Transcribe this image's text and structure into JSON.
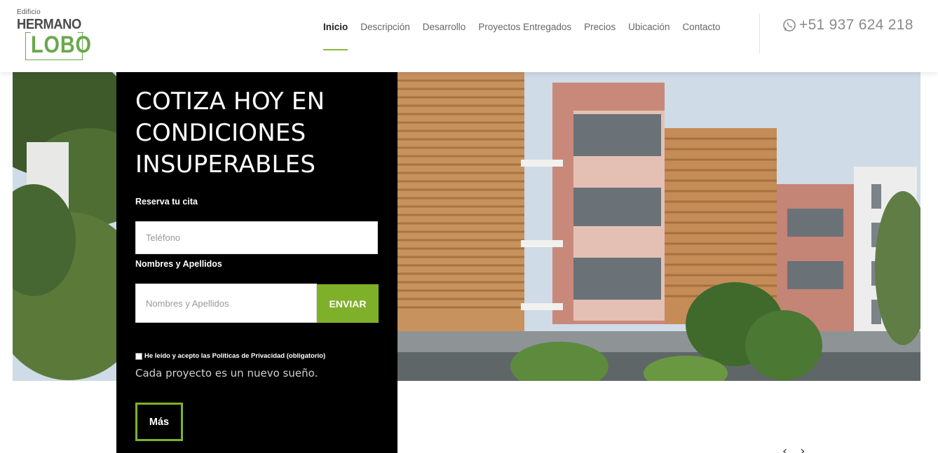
{
  "brand": {
    "small": "Edificio",
    "line1": "HERMANO",
    "line2": "LOBO",
    "accent": "#7fb02a"
  },
  "nav": {
    "items": [
      {
        "label": "Inicio",
        "active": true
      },
      {
        "label": "Descripción",
        "active": false
      },
      {
        "label": "Desarrollo",
        "active": false
      },
      {
        "label": "Proyectos Entregados",
        "active": false
      },
      {
        "label": "Precios",
        "active": false
      },
      {
        "label": "Ubicación",
        "active": false
      },
      {
        "label": "Contacto",
        "active": false
      }
    ]
  },
  "phone": {
    "icon": "whatsapp-icon",
    "number": "+51 937 624 218"
  },
  "hero": {
    "title": "COTIZA HOY EN CONDICIONES INSUPERABLES"
  },
  "form": {
    "label_reserve": "Reserva tu cita",
    "phone_placeholder": "Teléfono",
    "label_name": "Nombres y Apellidos",
    "name_placeholder": "Nombres y Apellidos",
    "send_label": "ENVIAR",
    "consent": "He leído y acepto las Políticas de Privacidad (obligatorio)"
  },
  "tagline": "Cada proyecto es un nuevo sueño.",
  "more_label": "Más",
  "slider": {
    "prev": "‹",
    "next": "›"
  }
}
